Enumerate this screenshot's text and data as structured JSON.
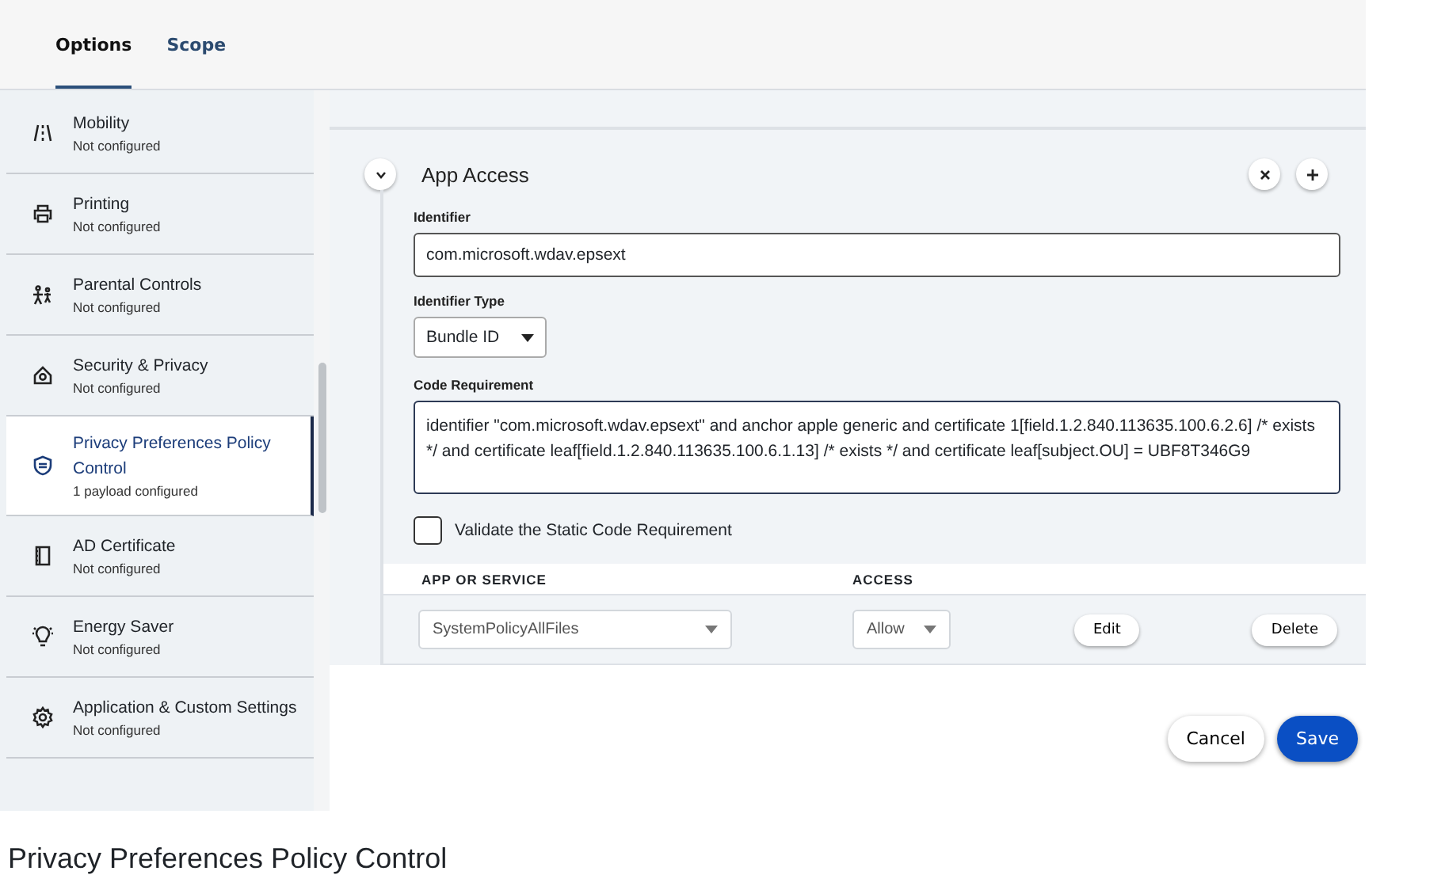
{
  "tabs": [
    {
      "label": "Options",
      "selected": true
    },
    {
      "label": "Scope",
      "selected": false
    }
  ],
  "sidebar": {
    "items": [
      {
        "kind": "mobility",
        "title": "Mobility",
        "subtitle": "Not configured",
        "selected": false
      },
      {
        "kind": "printer",
        "title": "Printing",
        "subtitle": "Not configured",
        "selected": false
      },
      {
        "kind": "people",
        "title": "Parental Controls",
        "subtitle": "Not configured",
        "selected": false
      },
      {
        "kind": "house",
        "title": "Security & Privacy",
        "subtitle": "Not configured",
        "selected": false
      },
      {
        "kind": "shield",
        "title": "Privacy Preferences Policy Control",
        "subtitle": "1 payload configured",
        "selected": true
      },
      {
        "kind": "book",
        "title": "AD Certificate",
        "subtitle": "Not configured",
        "selected": false
      },
      {
        "kind": "bulb",
        "title": "Energy Saver",
        "subtitle": "Not configured",
        "selected": false
      },
      {
        "kind": "gear",
        "title": "Application & Custom Settings",
        "subtitle": "Not configured",
        "selected": false
      }
    ]
  },
  "section": {
    "title": "App Access",
    "expanded": true,
    "identifier": {
      "label": "Identifier",
      "value": "com.microsoft.wdav.epsext"
    },
    "identifier_type": {
      "label": "Identifier Type",
      "value": "Bundle ID"
    },
    "code_requirement": {
      "label": "Code Requirement",
      "value": "identifier \"com.microsoft.wdav.epsext\" and anchor apple generic and certificate 1[field.1.2.840.113635.100.6.2.6] /* exists */ and certificate leaf[field.1.2.840.113635.100.6.1.13] /* exists */ and certificate leaf[subject.OU] = UBF8T346G9"
    },
    "validate": {
      "label": "Validate the Static Code Requirement",
      "checked": false
    },
    "table": {
      "columns": [
        "APP OR SERVICE",
        "ACCESS"
      ],
      "rows": [
        {
          "app": "SystemPolicyAllFiles",
          "access": "Allow",
          "edit": "Edit",
          "delete": "Delete"
        }
      ]
    }
  },
  "buttons": {
    "cancel": "Cancel",
    "save": "Save"
  },
  "caption": "Privacy Preferences Policy Control"
}
